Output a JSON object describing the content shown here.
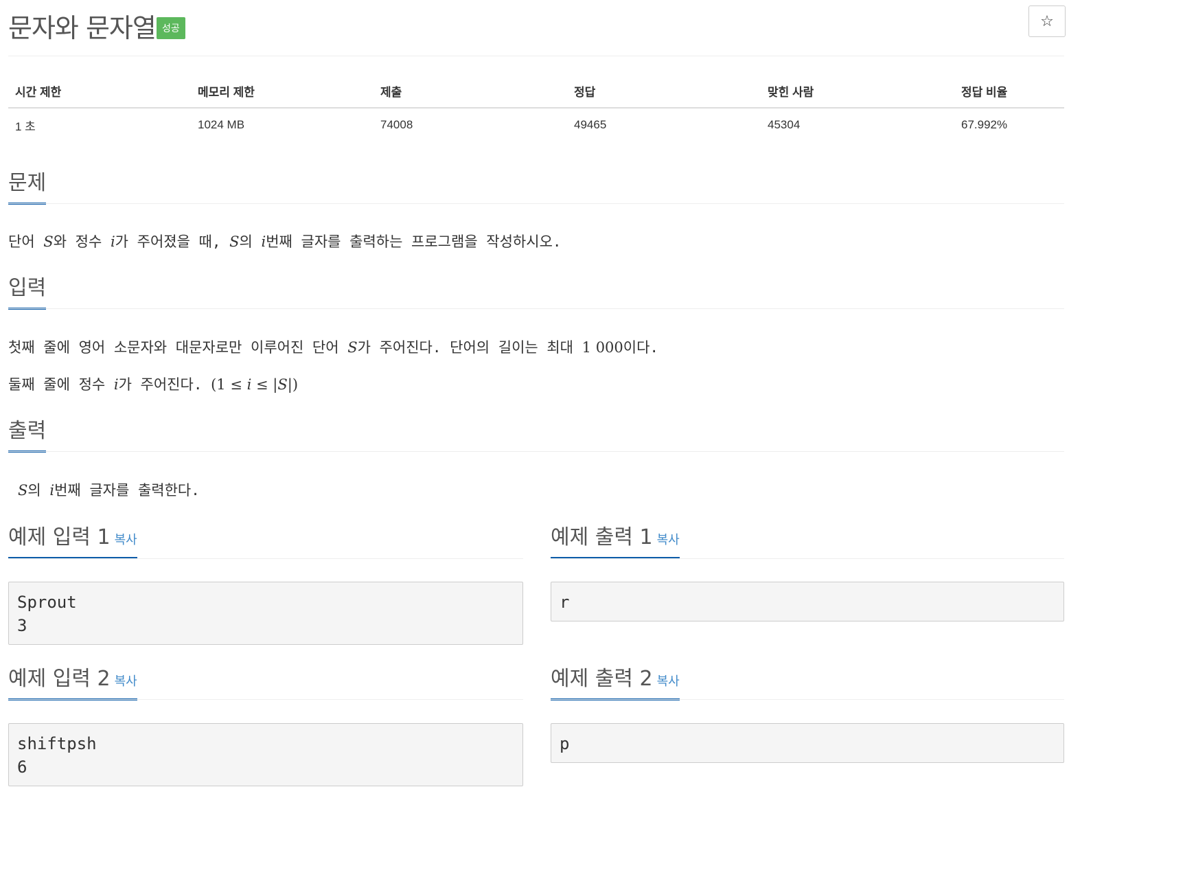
{
  "header": {
    "title": "문자와 문자열",
    "badge": "성공",
    "star_icon": "☆"
  },
  "info": {
    "headers": [
      "시간 제한",
      "메모리 제한",
      "제출",
      "정답",
      "맞힌 사람",
      "정답 비율"
    ],
    "values": [
      "1 초",
      "1024 MB",
      "74008",
      "49465",
      "45304",
      "67.992%"
    ]
  },
  "problem": {
    "title": "문제",
    "p1": [
      "단어 ",
      "S",
      "와 정수 ",
      "i",
      "가 주어졌을 때, ",
      "S",
      "의 ",
      "i",
      "번째 글자를 출력하는 프로그램을 작성하시오."
    ]
  },
  "input": {
    "title": "입력",
    "p1": [
      "첫째 줄에 영어 소문자와 대문자로만 이루어진 단어 ",
      "S",
      "가 주어진다. 단어의 길이는 최대 ",
      "1 000",
      "이다."
    ],
    "p2": [
      "둘째 줄에 정수 ",
      "i",
      "가 주어진다. ",
      "(1 ≤ ",
      "i",
      " ≤ |",
      "S",
      "|)"
    ]
  },
  "output": {
    "title": "출력",
    "p1": [
      "S",
      "의 ",
      "i",
      "번째 글자를 출력한다."
    ]
  },
  "samples": {
    "copy_label": "복사",
    "in1_title": "예제 입력 1",
    "in1_body": "Sprout\n3",
    "out1_title": "예제 출력 1",
    "out1_body": "r",
    "in2_title": "예제 입력 2",
    "in2_body": "shiftpsh\n6",
    "out2_title": "예제 출력 2",
    "out2_body": "p"
  },
  "colors": {
    "accent": "#0d5ca8",
    "badge": "#5cb85c",
    "link": "#428bca"
  }
}
